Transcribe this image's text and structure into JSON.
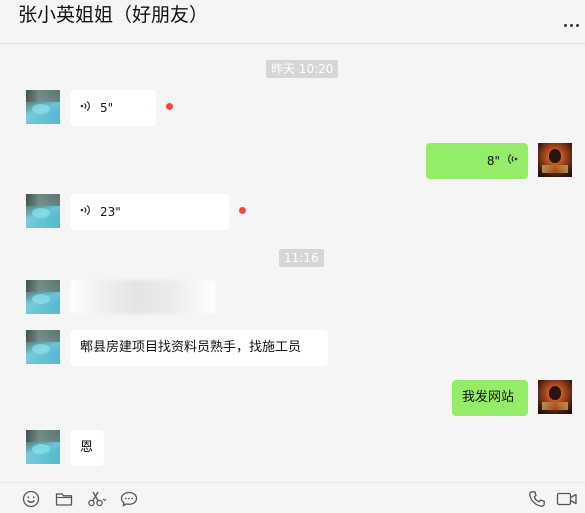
{
  "header": {
    "title": "张小英姐姐（好朋友）",
    "more_icon": "more-icon"
  },
  "timestamps": [
    "昨天 10:20",
    "11:16"
  ],
  "messages": [
    {
      "side": "left",
      "type": "voice",
      "duration": "5\"",
      "unread": true
    },
    {
      "side": "right",
      "type": "voice",
      "duration": "8\""
    },
    {
      "side": "left",
      "type": "voice",
      "duration": "23\"",
      "unread": true
    },
    {
      "side": "left",
      "type": "blurred_text"
    },
    {
      "side": "left",
      "type": "text",
      "text": "郫县房建项目找资料员熟手，找施工员"
    },
    {
      "side": "right",
      "type": "text",
      "text": "我发网站"
    },
    {
      "side": "left",
      "type": "text",
      "text": "恩"
    }
  ],
  "toolbar": {
    "left_icons": [
      "emoji-icon",
      "folder-icon",
      "scissors-icon",
      "chat-bubble-icon"
    ],
    "right_icons": [
      "phone-icon",
      "video-call-icon"
    ]
  },
  "colors": {
    "green_bubble": "#95ec69",
    "white_bubble": "#ffffff",
    "unread_dot": "#f04848",
    "background": "#f5f5f5"
  }
}
